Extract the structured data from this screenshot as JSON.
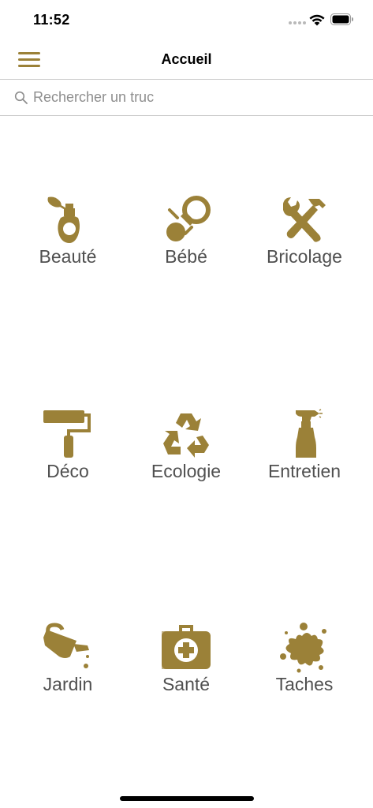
{
  "status_bar": {
    "time": "11:52"
  },
  "nav": {
    "title": "Accueil",
    "menu_icon": "hamburger-menu-icon"
  },
  "search": {
    "placeholder": "Rechercher un truc",
    "value": "",
    "icon": "search-icon"
  },
  "colors": {
    "accent": "#9b8138",
    "label": "#505050",
    "divider": "#c8c8c8"
  },
  "categories": [
    {
      "label": "Beauté",
      "icon": "perfume-bottle-icon"
    },
    {
      "label": "Bébé",
      "icon": "pacifier-icon"
    },
    {
      "label": "Bricolage",
      "icon": "wrench-hammer-icon"
    },
    {
      "label": "Déco",
      "icon": "paint-roller-icon"
    },
    {
      "label": "Ecologie",
      "icon": "recycle-icon"
    },
    {
      "label": "Entretien",
      "icon": "spray-bottle-icon"
    },
    {
      "label": "Jardin",
      "icon": "watering-can-icon"
    },
    {
      "label": "Santé",
      "icon": "first-aid-kit-icon"
    },
    {
      "label": "Taches",
      "icon": "stain-splash-icon"
    }
  ]
}
